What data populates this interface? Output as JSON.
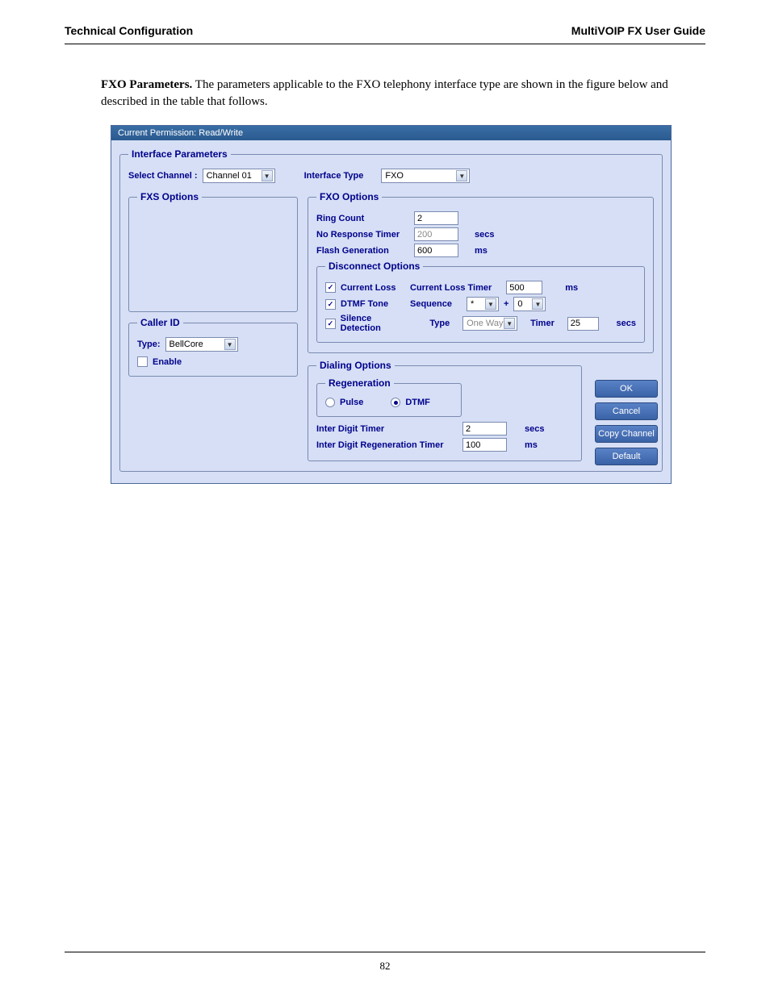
{
  "header": {
    "left": "Technical Configuration",
    "right": "MultiVOIP FX User Guide"
  },
  "intro": {
    "bold": "FXO Parameters.",
    "rest": "  The parameters applicable to the FXO telephony interface type are shown in the figure below and described in the table that follows."
  },
  "dialog": {
    "titlebar": "Current Permission:  Read/Write",
    "interface_params": {
      "legend": "Interface Parameters",
      "select_channel_label": "Select Channel :",
      "select_channel_value": "Channel 01",
      "interface_type_label": "Interface Type",
      "interface_type_value": "FXO"
    },
    "fxs": {
      "legend": "FXS Options"
    },
    "caller_id": {
      "legend": "Caller ID",
      "type_label": "Type:",
      "type_value": "BellCore",
      "enable_label": "Enable",
      "enable_checked": false
    },
    "fxo": {
      "legend": "FXO Options",
      "ring_count_label": "Ring Count",
      "ring_count_value": "2",
      "no_response_label": "No Response Timer",
      "no_response_value": "200",
      "no_response_unit": "secs",
      "flash_label": "Flash Generation",
      "flash_value": "600",
      "flash_unit": "ms"
    },
    "disconnect": {
      "legend": "Disconnect Options",
      "current_loss_label": "Current Loss",
      "current_loss_checked": true,
      "current_loss_timer_label": "Current Loss Timer",
      "current_loss_timer_value": "500",
      "current_loss_timer_unit": "ms",
      "dtmf_label": "DTMF Tone",
      "dtmf_checked": true,
      "sequence_label": "Sequence",
      "sequence_a": "*",
      "sequence_plus": "+",
      "sequence_b": "0",
      "silence_label": "Silence Detection",
      "silence_checked": true,
      "silence_type_label": "Type",
      "silence_type_value": "One Way",
      "silence_timer_label": "Timer",
      "silence_timer_value": "25",
      "silence_timer_unit": "secs"
    },
    "dialing": {
      "legend": "Dialing Options",
      "regen_legend": "Regeneration",
      "pulse_label": "Pulse",
      "pulse_selected": false,
      "dtmf_label": "DTMF",
      "dtmf_selected": true,
      "inter_digit_label": "Inter Digit Timer",
      "inter_digit_value": "2",
      "inter_digit_unit": "secs",
      "inter_digit_regen_label": "Inter Digit Regeneration Timer",
      "inter_digit_regen_value": "100",
      "inter_digit_regen_unit": "ms"
    },
    "buttons": {
      "ok": "OK",
      "cancel": "Cancel",
      "copy": "Copy Channel",
      "default": "Default"
    }
  },
  "footer": {
    "page": "82"
  }
}
